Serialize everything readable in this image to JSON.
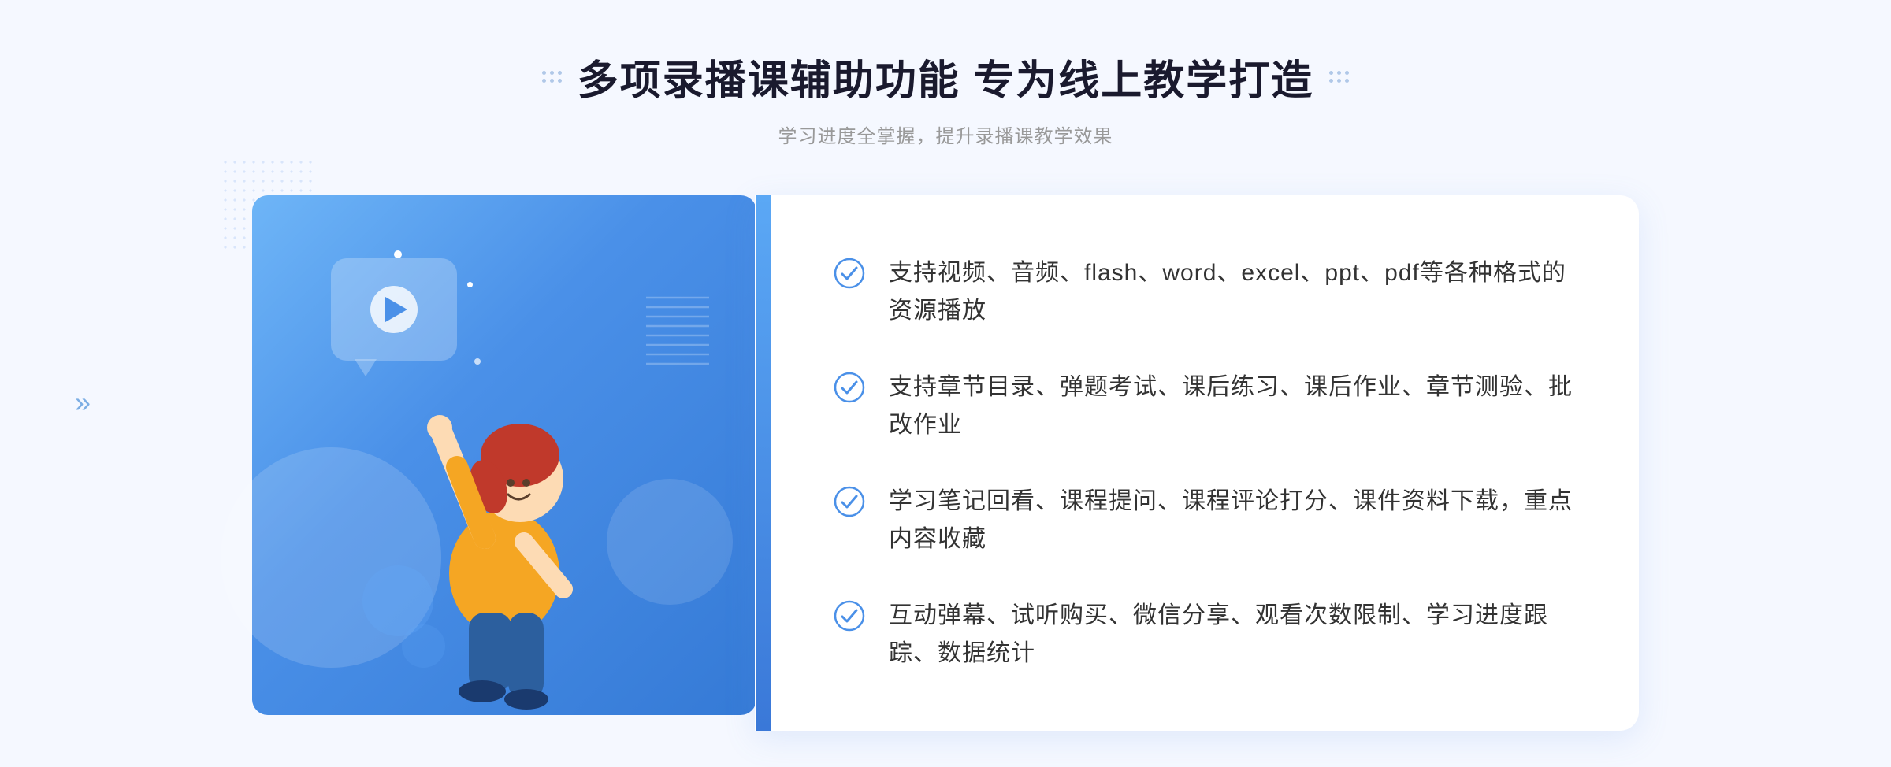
{
  "page": {
    "background_color": "#f5f8ff"
  },
  "header": {
    "title": "多项录播课辅助功能 专为线上教学打造",
    "subtitle": "学习进度全掌握，提升录播课教学效果"
  },
  "features": [
    {
      "id": 1,
      "text": "支持视频、音频、flash、word、excel、ppt、pdf等各种格式的资源播放"
    },
    {
      "id": 2,
      "text": "支持章节目录、弹题考试、课后练习、课后作业、章节测验、批改作业"
    },
    {
      "id": 3,
      "text": "学习笔记回看、课程提问、课程评论打分、课件资料下载，重点内容收藏"
    },
    {
      "id": 4,
      "text": "互动弹幕、试听购买、微信分享、观看次数限制、学习进度跟踪、数据统计"
    }
  ],
  "icons": {
    "check": "check-circle-icon",
    "play": "play-icon",
    "chevron": "chevron-left-icon"
  }
}
